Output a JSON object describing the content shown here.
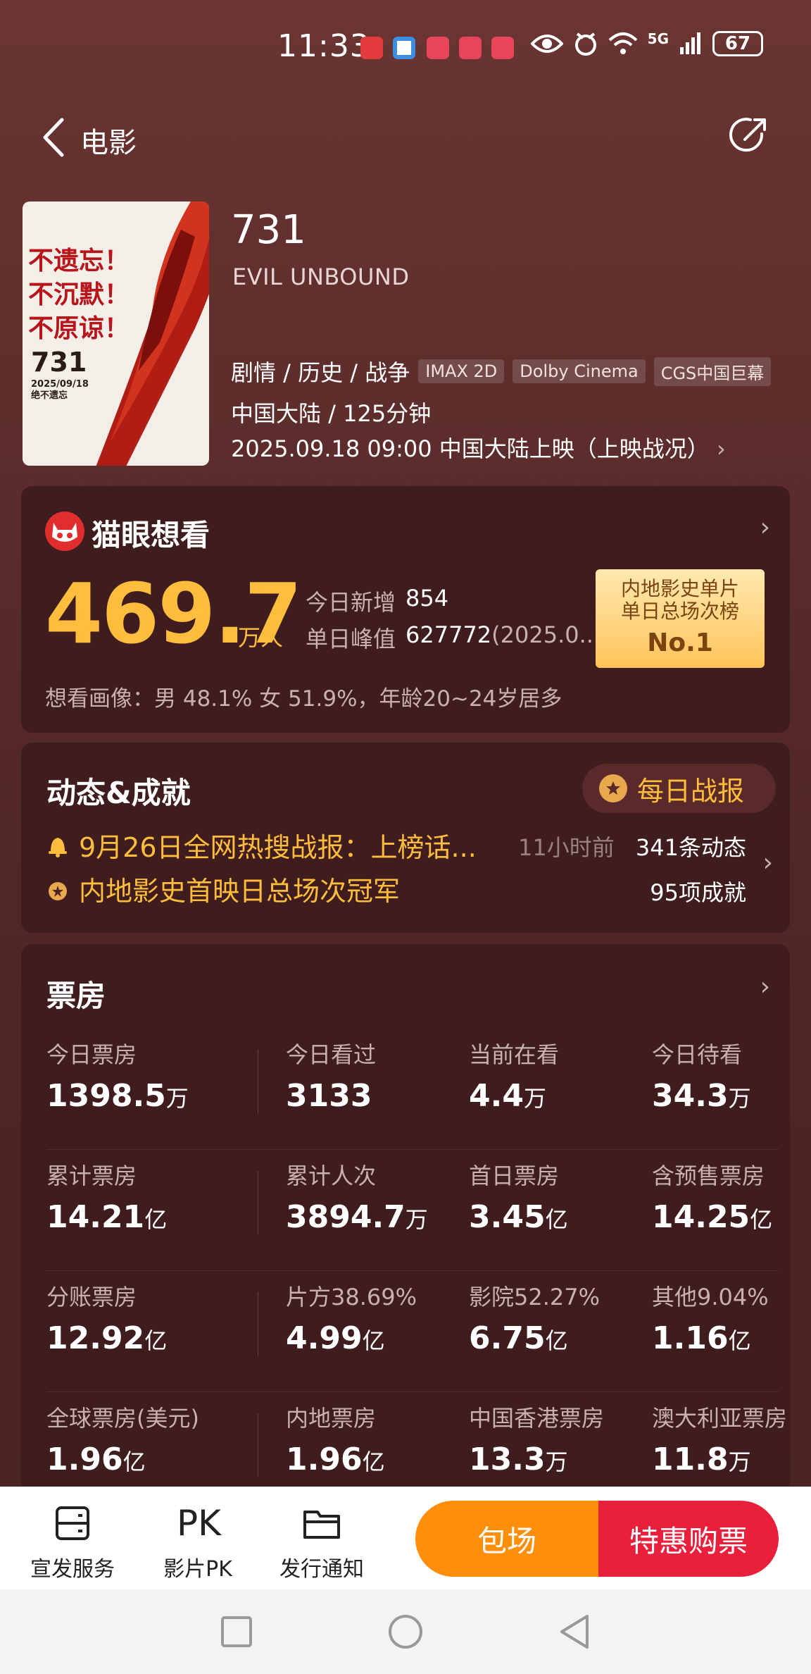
{
  "status_bar": {
    "time": "11:33",
    "network": "5G",
    "battery": "67",
    "icons": [
      "eye-icon",
      "alarm-icon",
      "wifi-icon",
      "signal-icon"
    ]
  },
  "nav": {
    "back_label": "电影"
  },
  "movie": {
    "title": "731",
    "subtitle": "EVIL UNBOUND",
    "genres": "剧情 / 历史 / 战争",
    "tags": [
      "IMAX 2D",
      "Dolby Cinema",
      "CGS中国巨幕"
    ],
    "region_duration": "中国大陆 / 125分钟",
    "release": "2025.09.18 09:00 中国大陆上映（上映战况）",
    "poster": {
      "slogan": [
        "不遗忘！",
        "不沉默！",
        "不原谅！"
      ],
      "number": "731",
      "date": "2025/09/18",
      "tagline": "绝不遗忘"
    }
  },
  "want": {
    "title": "猫眼想看",
    "count": "469.7",
    "unit": "万人",
    "today_new_label": "今日新增",
    "today_new_value": "854",
    "peak_label": "单日峰值",
    "peak_value": "627772",
    "peak_date": "(2025.0...",
    "rank_line1": "内地影史单片",
    "rank_line2": "单日总场次榜",
    "rank": "No.1",
    "portrait": "想看画像：男 48.1%  女 51.9%，年龄20~24岁居多"
  },
  "dynamics": {
    "title": "动态&成就",
    "daily_report": "每日战报",
    "item1": "9月26日全网热搜战报：上榜话...",
    "item1_time": "11小时前",
    "item1_count": "341条动态",
    "item2": "内地影史首映日总场次冠军",
    "item2_count": "95项成就"
  },
  "box_office": {
    "title": "票房",
    "rows": [
      [
        {
          "label": "今日票房",
          "value": "1398.5",
          "unit": "万"
        },
        {
          "label": "今日看过",
          "value": "3133",
          "unit": ""
        },
        {
          "label": "当前在看",
          "value": "4.4",
          "unit": "万"
        },
        {
          "label": "今日待看",
          "value": "34.3",
          "unit": "万"
        }
      ],
      [
        {
          "label": "累计票房",
          "value": "14.21",
          "unit": "亿"
        },
        {
          "label": "累计人次",
          "value": "3894.7",
          "unit": "万"
        },
        {
          "label": "首日票房",
          "value": "3.45",
          "unit": "亿"
        },
        {
          "label": "含预售票房",
          "value": "14.25",
          "unit": "亿"
        }
      ],
      [
        {
          "label": "分账票房",
          "value": "12.92",
          "unit": "亿"
        },
        {
          "label": "片方38.69%",
          "value": "4.99",
          "unit": "亿"
        },
        {
          "label": "影院52.27%",
          "value": "6.75",
          "unit": "亿"
        },
        {
          "label": "其他9.04%",
          "value": "1.16",
          "unit": "亿"
        }
      ],
      [
        {
          "label": "全球票房(美元)",
          "value": "1.96",
          "unit": "亿"
        },
        {
          "label": "内地票房",
          "value": "1.96",
          "unit": "亿"
        },
        {
          "label": "中国香港票房",
          "value": "13.3",
          "unit": "万"
        },
        {
          "label": "澳大利亚票房",
          "value": "11.8",
          "unit": "万"
        }
      ]
    ]
  },
  "bottom_bar": {
    "items": [
      {
        "label": "宣发服务",
        "icon": "server-icon"
      },
      {
        "label": "影片PK",
        "icon": "pk-icon"
      },
      {
        "label": "发行通知",
        "icon": "folder-icon"
      }
    ],
    "pk_glyph": "PK",
    "btn_pack": "包场",
    "btn_buy": "特惠购票"
  },
  "colors": {
    "accent_gold": "#ffbd3d",
    "card_bg": "#3f1c1d",
    "orange": "#ff8f0a",
    "red": "#e8203c"
  }
}
